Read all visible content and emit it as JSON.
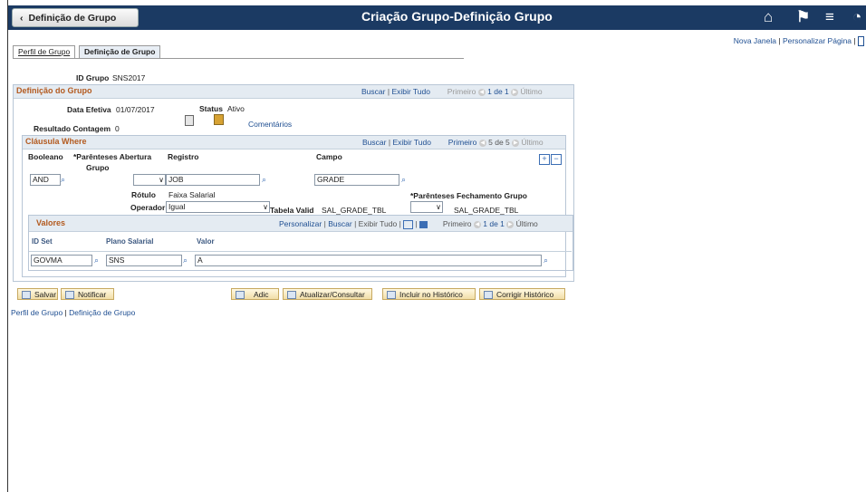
{
  "header": {
    "back_label": "Definição de Grupo",
    "title": "Criação Grupo-Definição Grupo",
    "links": {
      "nova_janela": "Nova Janela",
      "sep1": "|",
      "personalizar": "Personalizar Página",
      "sep2": "|"
    }
  },
  "tabs": [
    {
      "label": "Perfil de Grupo"
    },
    {
      "label": "Definição de Grupo"
    }
  ],
  "group": {
    "id_label": "ID Grupo",
    "id_value": "SNS2017"
  },
  "definicao": {
    "title": "Definição do Grupo",
    "nav": {
      "buscar": "Buscar",
      "sep": "|",
      "exibir": "Exibir Tudo",
      "primeiro": "Primeiro",
      "pos": "1 de 1",
      "ultimo": "Último"
    },
    "data_label": "Data Efetiva",
    "data_value": "01/07/2017",
    "status_label": "Status",
    "status_value": "Ativo",
    "comentarios": "Comentários",
    "resultado_label": "Resultado Contagem",
    "resultado_value": "0"
  },
  "clausula": {
    "title": "Cláusula Where",
    "nav": {
      "buscar": "Buscar",
      "sep": "|",
      "exibir": "Exibir Tudo",
      "primeiro": "Primeiro",
      "pos": "5 de 5",
      "ultimo": "Último"
    },
    "booleano_label": "Booleano",
    "parenteses_label_1": "*Parênteses Abertura",
    "parenteses_label_2": "Grupo",
    "registro_label": "Registro",
    "campo_label": "Campo",
    "booleano_value": "AND",
    "registro_value": "JOB",
    "campo_value": "GRADE",
    "rotulo_label": "Rótulo",
    "rotulo_value": "Faixa Salarial",
    "fechamento_label": "*Parênteses Fechamento Grupo",
    "operador_label": "Operador",
    "operador_value": "Igual",
    "tabela_label": "Tabela Valid",
    "tabela_value": "SAL_GRADE_TBL",
    "tabela_value_2": "SAL_GRADE_TBL"
  },
  "valores": {
    "title": "Valores",
    "nav": {
      "personalizar": "Personalizar",
      "sep": "|",
      "buscar": "Buscar",
      "exibir": "Exibir Tudo",
      "primeiro": "Primeiro",
      "pos": "1 de 1",
      "ultimo": "Último"
    },
    "columns": [
      "ID Set",
      "Plano Salarial",
      "Valor"
    ],
    "row": {
      "id_set": "GOVMA",
      "plano": "SNS",
      "valor": "A"
    }
  },
  "buttons": {
    "salvar": "Salvar",
    "notificar": "Notificar",
    "adic": "Adic",
    "atualizar": "Atualizar/Consultar",
    "incluir": "Incluir no Histórico",
    "corrigir": "Corrigir Histórico"
  },
  "footer": {
    "perfil": "Perfil de Grupo",
    "sep": "|",
    "definicao": "Definição de Grupo"
  }
}
